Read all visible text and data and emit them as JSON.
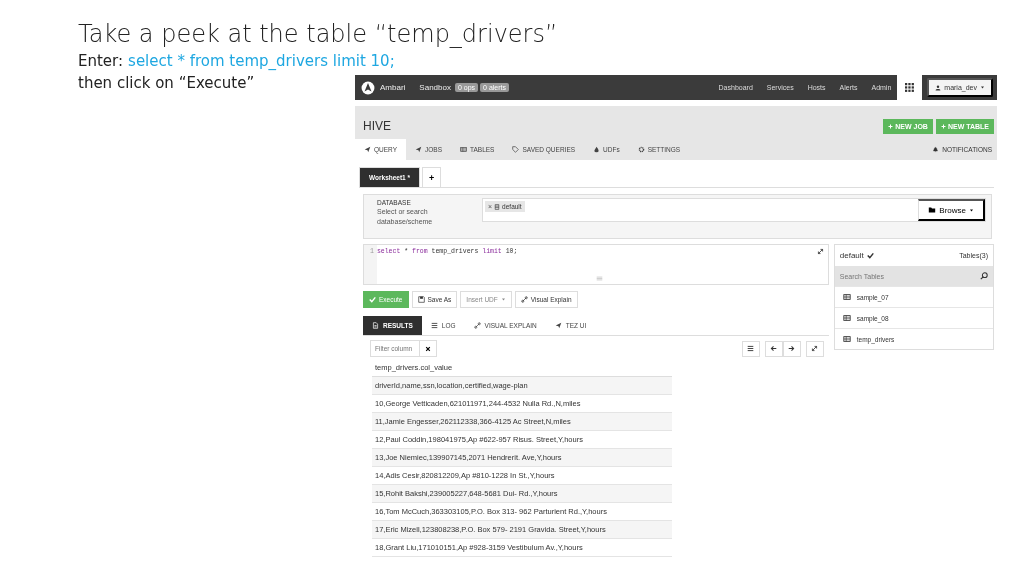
{
  "slide": {
    "title": "Take a peek at the table “temp_drivers”",
    "enter_label": "Enter:",
    "command": "select * from temp_drivers limit 10;",
    "note": "then click on “Execute”"
  },
  "navbar": {
    "brand": "Ambari",
    "cluster": "Sandbox",
    "badges": [
      "0 ops",
      "0 alerts"
    ],
    "links": [
      "Dashboard",
      "Services",
      "Hosts",
      "Alerts",
      "Admin"
    ],
    "user": "maria_dev"
  },
  "view": {
    "title": "HIVE",
    "actions": [
      "NEW JOB",
      "NEW TABLE"
    ],
    "tabs": [
      {
        "label": "QUERY",
        "selected": true
      },
      {
        "label": "JOBS",
        "selected": false
      },
      {
        "label": "TABLES",
        "selected": false
      },
      {
        "label": "SAVED QUERIES",
        "selected": false
      },
      {
        "label": "UDFs",
        "selected": false
      },
      {
        "label": "SETTINGS",
        "selected": false
      }
    ],
    "notifications": "NOTIFICATIONS"
  },
  "worksheets": [
    {
      "label": "Worksheet1 *",
      "selected": true
    }
  ],
  "add_worksheet": "+",
  "database": {
    "remove": "×",
    "label": "DATABASE",
    "hint": "Select or search database/scheme",
    "selected": "default",
    "browse": "Browse"
  },
  "editor": {
    "line_number": "1",
    "tokens": [
      {
        "text": "select",
        "kind": "keyword"
      },
      {
        "text": " * ",
        "kind": "plain"
      },
      {
        "text": "from",
        "kind": "keyword"
      },
      {
        "text": " temp_drivers ",
        "kind": "plain"
      },
      {
        "text": "limit",
        "kind": "keyword"
      },
      {
        "text": " 10;",
        "kind": "plain"
      }
    ]
  },
  "buttons": [
    {
      "label": "Execute",
      "kind": "primary",
      "disabled": false
    },
    {
      "label": "Save As",
      "kind": "default",
      "disabled": false
    },
    {
      "label": "Insert UDF",
      "kind": "dropdown",
      "disabled": true
    },
    {
      "label": "Visual Explain",
      "kind": "default",
      "disabled": false
    }
  ],
  "result_tabs": [
    {
      "label": "RESULTS",
      "selected": true
    },
    {
      "label": "LOG",
      "selected": false
    },
    {
      "label": "VISUAL EXPLAIN",
      "selected": false
    },
    {
      "label": "TEZ UI",
      "selected": false
    }
  ],
  "filter": {
    "placeholder": "Filter column"
  },
  "results": {
    "column": "temp_drivers.col_value",
    "rows": [
      "driverId,name,ssn,location,certified,wage-plan",
      "10,George Vetticaden,621011971,244-4532 Nulla Rd.,N,miles",
      "11,Jamie Engesser,262112338,366-4125 Ac Street,N,miles",
      "12,Paul Coddin,198041975,Ap #622-957 Risus. Street,Y,hours",
      "13,Joe Niemiec,139907145,2071 Hendrerit. Ave,Y,hours",
      "14,Adis Cesir,820812209,Ap #810-1228 In St.,Y,hours",
      "15,Rohit Bakshi,239005227,648-5681 Dui- Rd.,Y,hours",
      "16,Tom McCuch,363303105,P.O. Box 313- 962 Parturient Rd.,Y,hours",
      "17,Eric Mizell,123808238,P.O. Box 579- 2191 Gravida. Street,Y,hours",
      "18,Grant Liu,171010151,Ap #928-3159 Vestibulum Av.,Y,hours"
    ]
  },
  "tables_panel": {
    "database": "default",
    "count": "Tables(3)",
    "search_placeholder": "Search Tables",
    "tables": [
      "sample_07",
      "sample_08",
      "temp_drivers"
    ]
  }
}
